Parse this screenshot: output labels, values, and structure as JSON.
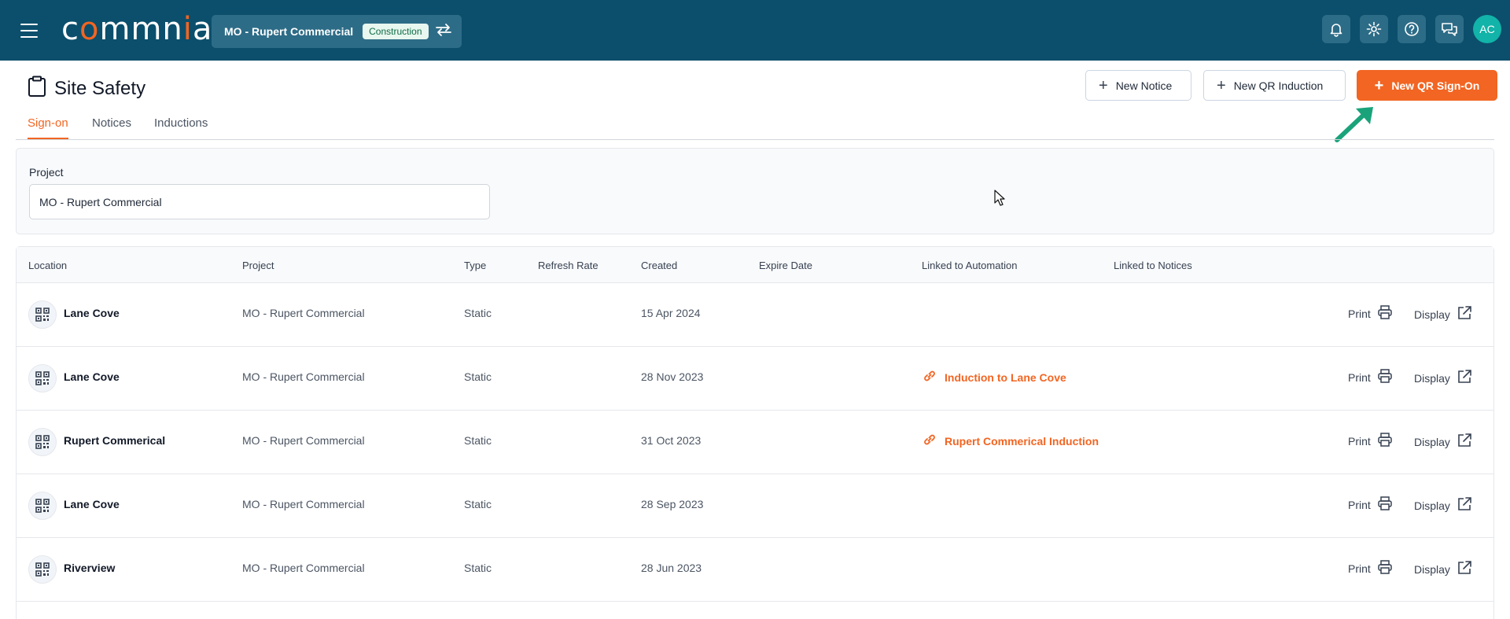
{
  "header": {
    "logo_text": "commnia",
    "project_name": "MO - Rupert Commercial",
    "project_badge": "Construction",
    "avatar_initials": "AC"
  },
  "page": {
    "title": "Site Safety",
    "buttons": {
      "new_notice": "New Notice",
      "new_qr_induction": "New QR Induction",
      "new_qr_signon": "New QR Sign-On"
    },
    "tabs": [
      "Sign-on",
      "Notices",
      "Inductions"
    ],
    "active_tab": "Sign-on"
  },
  "filter": {
    "label": "Project",
    "value": "MO - Rupert Commercial"
  },
  "table": {
    "columns": [
      "Location",
      "Project",
      "Type",
      "Refresh Rate",
      "Created",
      "Expire Date",
      "Linked to Automation",
      "Linked to Notices"
    ],
    "print_label": "Print",
    "display_label": "Display",
    "rows": [
      {
        "location": "Lane Cove",
        "project": "MO - Rupert Commercial",
        "type": "Static",
        "refresh_rate": "",
        "created": "15 Apr 2024",
        "expire_date": "",
        "automation": "",
        "notices": ""
      },
      {
        "location": "Lane Cove",
        "project": "MO - Rupert Commercial",
        "type": "Static",
        "refresh_rate": "",
        "created": "28 Nov 2023",
        "expire_date": "",
        "automation": "Induction to Lane Cove",
        "notices": ""
      },
      {
        "location": "Rupert Commerical",
        "project": "MO - Rupert Commercial",
        "type": "Static",
        "refresh_rate": "",
        "created": "31 Oct 2023",
        "expire_date": "",
        "automation": "Rupert Commerical Induction",
        "notices": ""
      },
      {
        "location": "Lane Cove",
        "project": "MO - Rupert Commercial",
        "type": "Static",
        "refresh_rate": "",
        "created": "28 Sep 2023",
        "expire_date": "",
        "automation": "",
        "notices": ""
      },
      {
        "location": "Riverview",
        "project": "MO - Rupert Commercial",
        "type": "Static",
        "refresh_rate": "",
        "created": "28 Jun 2023",
        "expire_date": "",
        "automation": "",
        "notices": ""
      }
    ]
  },
  "colors": {
    "header_bg": "#0b4f6c",
    "accent": "#f26522",
    "annotation_arrow": "#1aa37a"
  },
  "icons": [
    "menu-icon",
    "swap-icon",
    "bell-icon",
    "gear-icon",
    "help-icon",
    "chat-icon",
    "clipboard-icon",
    "plus-icon",
    "qr-code-icon",
    "link-icon",
    "printer-icon",
    "external-link-icon"
  ]
}
